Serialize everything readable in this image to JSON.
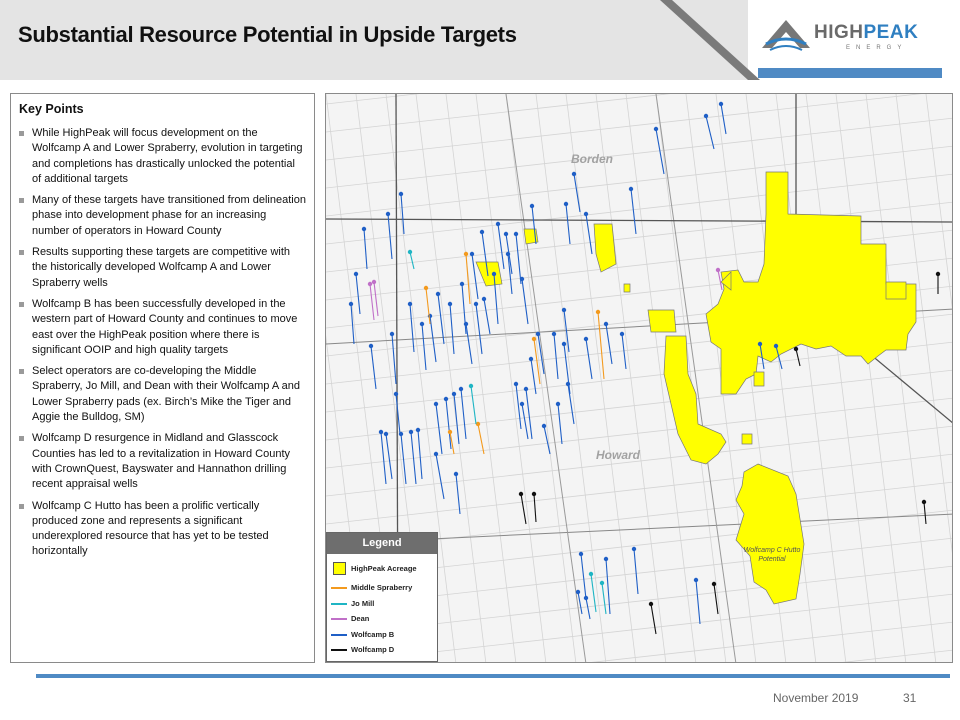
{
  "header": {
    "title": "Substantial Resource Potential in Upside Targets",
    "logo_primary": "HIGH",
    "logo_accent": "PEAK",
    "logo_sub": "ENERGY"
  },
  "key_points": {
    "title": "Key Points",
    "items": [
      "While HighPeak will focus development on the Wolfcamp A and Lower Spraberry, evolution in targeting and completions has drastically unlocked the potential of additional targets",
      "Many of these targets have transitioned from delineation phase into development phase for an increasing number of operators in Howard County",
      "Results supporting these targets are competitive with the historically developed Wolfcamp A and Lower Spraberry wells",
      "Wolfcamp B has been successfully developed in the western part of Howard County and continues to move east over the HighPeak position where there is significant OOIP and high quality targets",
      "Select operators are co-developing the Middle Spraberry, Jo Mill, and Dean with their Wolfcamp A and Lower Spraberry pads (ex. Birch’s Mike the Tiger and Aggie the Bulldog, SM)",
      "Wolfcamp D resurgence in Midland and Glasscock Counties has led to a revitalization in Howard County with CrownQuest, Bayswater and Hannathon drilling recent appraisal wells",
      "Wolfcamp C Hutto has been a prolific vertically produced zone and represents a significant underexplored resource that has yet to be tested horizontally"
    ]
  },
  "map": {
    "county_labels": {
      "borden": "Borden",
      "howard": "Howard"
    },
    "hutto_label": "Wolfcamp C Hutto Potential",
    "legend": {
      "title": "Legend",
      "items": [
        {
          "label": "HighPeak Acreage",
          "color": "#ffff00"
        },
        {
          "label": "Middle Spraberry",
          "color": "#f39a1e"
        },
        {
          "label": "Jo Mill",
          "color": "#1fb5c4"
        },
        {
          "label": "Dean",
          "color": "#c070c8"
        },
        {
          "label": "Wolfcamp B",
          "color": "#1f5fc6"
        },
        {
          "label": "Wolfcamp D",
          "color": "#111111"
        }
      ]
    }
  },
  "footer": {
    "date": "November  2019",
    "page": "31"
  },
  "colors": {
    "accent": "#4f8ac4",
    "acreage": "#ffff00",
    "header_band": "#e4e4e4"
  }
}
